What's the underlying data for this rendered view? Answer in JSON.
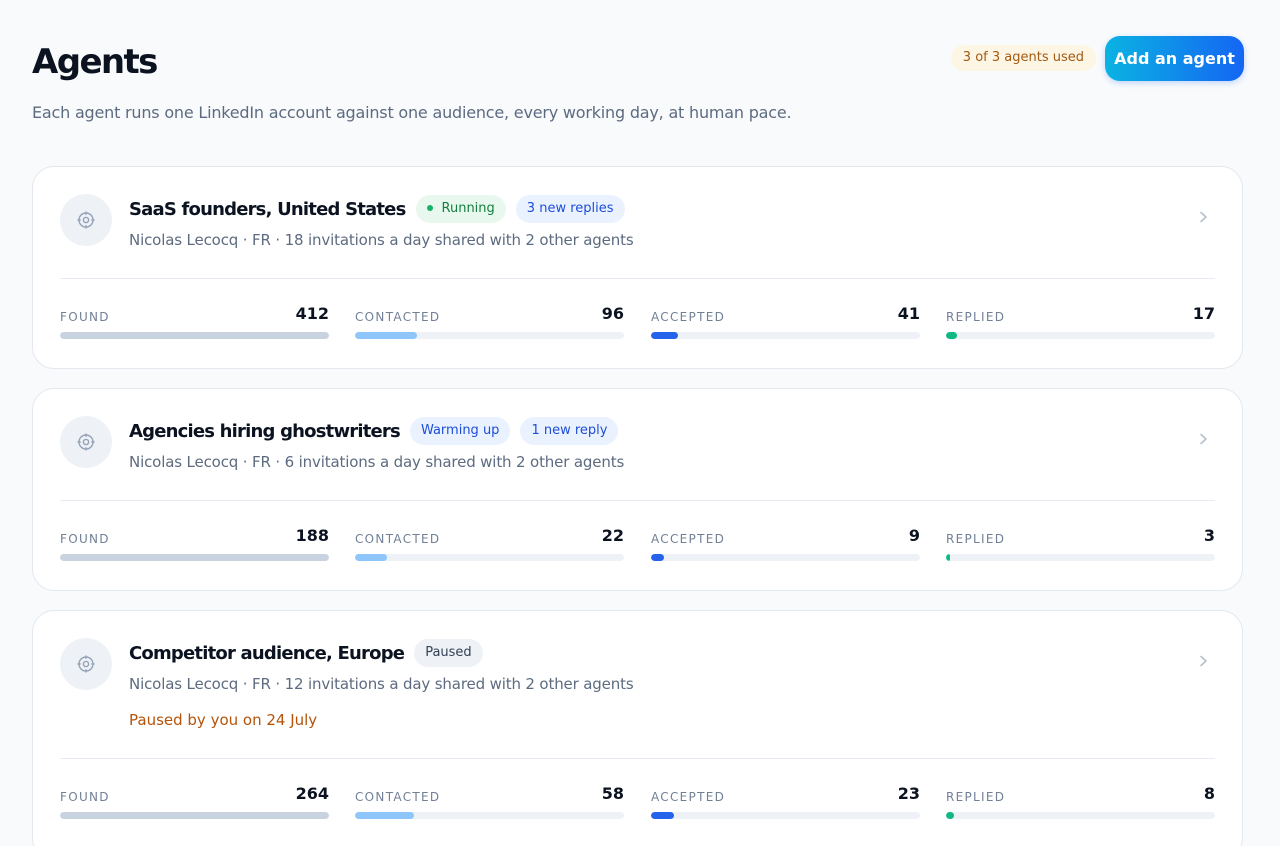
{
  "header": {
    "title": "Agents",
    "usage_badge": "3 of 3 agents used",
    "add_button": "Add an agent",
    "subtitle": "Each agent runs one LinkedIn account against one audience, every working day, at human pace."
  },
  "colors": {
    "accent_gradient_start": "#0ab3e2",
    "accent_gradient_end": "#1566f3",
    "running": "#16b364",
    "paused_note": "#b45309"
  },
  "stat_labels": {
    "found": "FOUND",
    "contacted": "CONTACTED",
    "accepted": "ACCEPTED",
    "replied": "REPLIED"
  },
  "agents": [
    {
      "name": "SaaS founders, United States",
      "status": "Running",
      "replies_badge": "3 new replies",
      "meta": "Nicolas Lecocq · FR · 18 invitations a day shared with 2 other agents",
      "stats": {
        "found": "412",
        "contacted": "96",
        "accepted": "41",
        "replied": "17"
      },
      "progress": {
        "found": 1.0,
        "contacted": 0.23,
        "accepted": 0.1,
        "replied": 0.04
      }
    },
    {
      "name": "Agencies hiring ghostwriters",
      "status": "Warming up",
      "replies_badge": "1 new reply",
      "meta": "Nicolas Lecocq · FR · 6 invitations a day shared with 2 other agents",
      "stats": {
        "found": "188",
        "contacted": "22",
        "accepted": "9",
        "replied": "3"
      },
      "progress": {
        "found": 1.0,
        "contacted": 0.12,
        "accepted": 0.05,
        "replied": 0.016
      }
    },
    {
      "name": "Competitor audience, Europe",
      "status": "Paused",
      "paused_note": "Paused by you on 24 July",
      "meta": "Nicolas Lecocq · FR · 12 invitations a day shared with 2 other agents",
      "stats": {
        "found": "264",
        "contacted": "58",
        "accepted": "23",
        "replied": "8"
      },
      "progress": {
        "found": 1.0,
        "contacted": 0.22,
        "accepted": 0.087,
        "replied": 0.03
      }
    }
  ]
}
